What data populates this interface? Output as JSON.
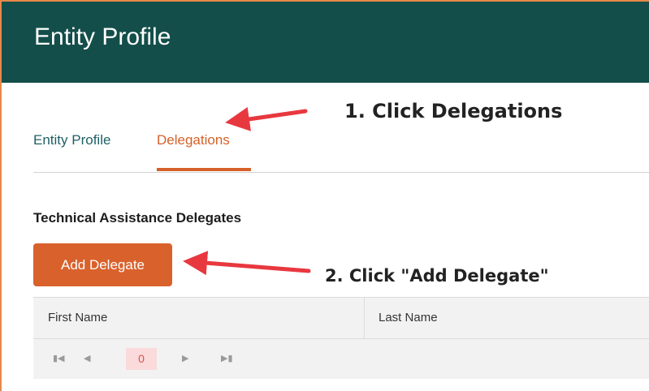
{
  "header": {
    "title": "Entity Profile"
  },
  "tabs": [
    {
      "label": "Entity Profile",
      "active": false
    },
    {
      "label": "Delegations",
      "active": true
    }
  ],
  "section": {
    "title": "Technical Assistance Delegates"
  },
  "actions": {
    "add_label": "Add Delegate"
  },
  "table": {
    "columns": [
      "First Name",
      "Last Name"
    ],
    "pager": {
      "current_page": "0"
    }
  },
  "annotations": {
    "step1": "1. Click Delegations",
    "step2": "2. Click \"Add Delegate\""
  },
  "colors": {
    "header_bg": "#134e4a",
    "accent": "#d9612c",
    "arrow": "#e8383f",
    "tab_text": "#1f5f66"
  },
  "icons": [
    "first-page-icon",
    "prev-page-icon",
    "next-page-icon",
    "last-page-icon",
    "arrow-annotation-icon"
  ]
}
